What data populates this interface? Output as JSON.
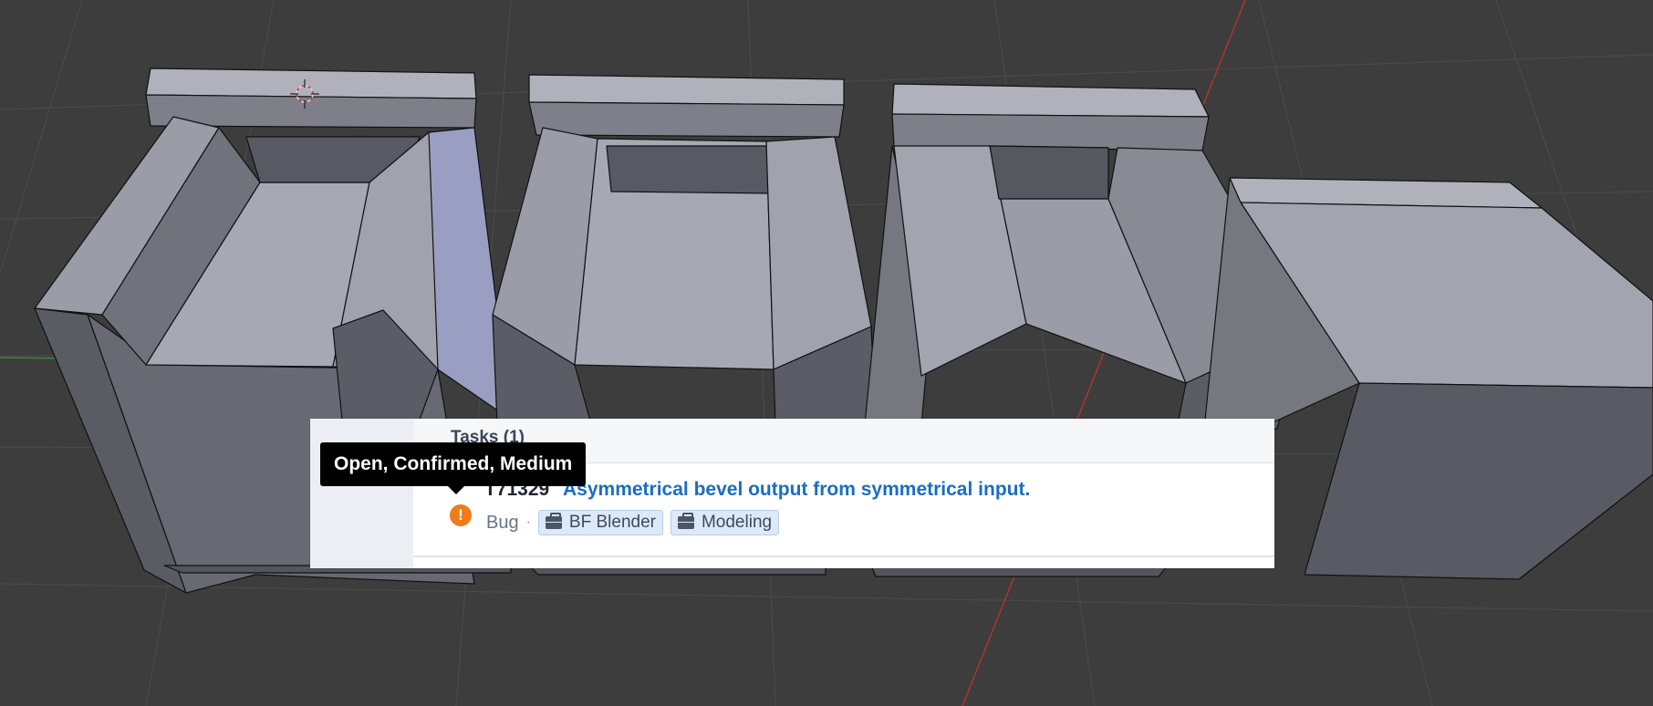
{
  "colors": {
    "viewport_bg": "#3d3d3d",
    "mesh_light": "#a6a6b2",
    "mesh_dark": "#5f5f69",
    "link": "#1b6dc1",
    "status_orange": "#f07b1a"
  },
  "viewport": {
    "icons": [
      "3d-cursor-icon",
      "x-axis-line",
      "y-axis-line"
    ]
  },
  "task_panel": {
    "title": "Tasks (1)",
    "tasks": [
      {
        "id": "T71329",
        "title": "Asymmetrical bevel output from symmetrical input.",
        "subtype": "Bug",
        "separator": "·",
        "status_icon": "exclamation-circle-icon",
        "tags": [
          {
            "label": "BF Blender",
            "icon": "briefcase-icon"
          },
          {
            "label": "Modeling",
            "icon": "briefcase-icon"
          }
        ]
      }
    ]
  },
  "tooltip": {
    "text": "Open, Confirmed, Medium"
  }
}
